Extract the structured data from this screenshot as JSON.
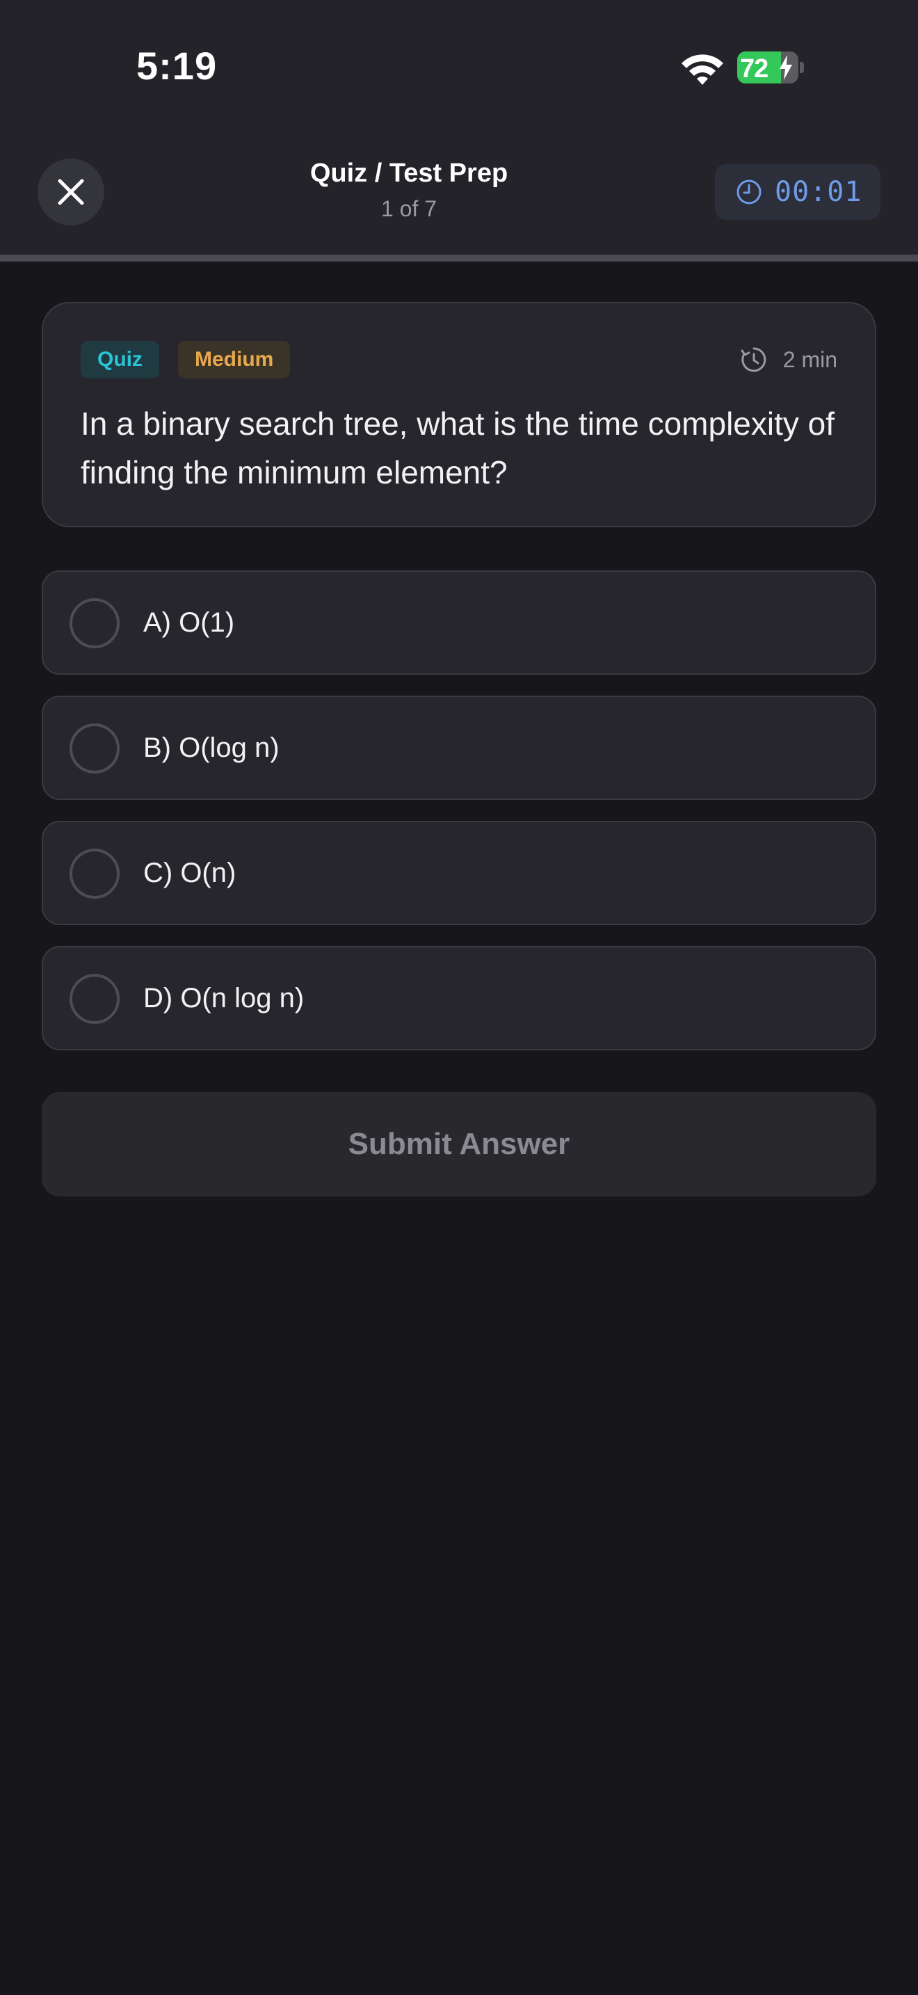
{
  "status_bar": {
    "time": "5:19",
    "battery_level": "72",
    "battery_fraction": 0.72
  },
  "nav": {
    "title": "Quiz / Test Prep",
    "subtitle": "1 of 7",
    "timer": "00:01",
    "progress_fraction": 0.0
  },
  "question": {
    "tags": [
      {
        "label": "Quiz",
        "color": "#2ac3d6"
      },
      {
        "label": "Medium",
        "color": "#e8a94b"
      }
    ],
    "duration": "2 min",
    "text": "In a binary search tree, what is the time complexity of finding the minimum element?"
  },
  "options": [
    {
      "label": "A) O(1)",
      "selected": false
    },
    {
      "label": "B) O(log n)",
      "selected": false
    },
    {
      "label": "C) O(n)",
      "selected": false
    },
    {
      "label": "D) O(n log n)",
      "selected": false
    }
  ],
  "submit": {
    "label": "Submit Answer",
    "enabled": false
  },
  "icons": {
    "close": "close-icon",
    "timer": "clock-icon",
    "duration": "stopwatch-icon",
    "wifi": "wifi-icon",
    "battery": "battery-icon"
  },
  "colors": {
    "background": "#16161b",
    "header": "#232329",
    "card": "#26262c",
    "timer_text": "#6f9be8",
    "battery_fill": "#34c759"
  }
}
